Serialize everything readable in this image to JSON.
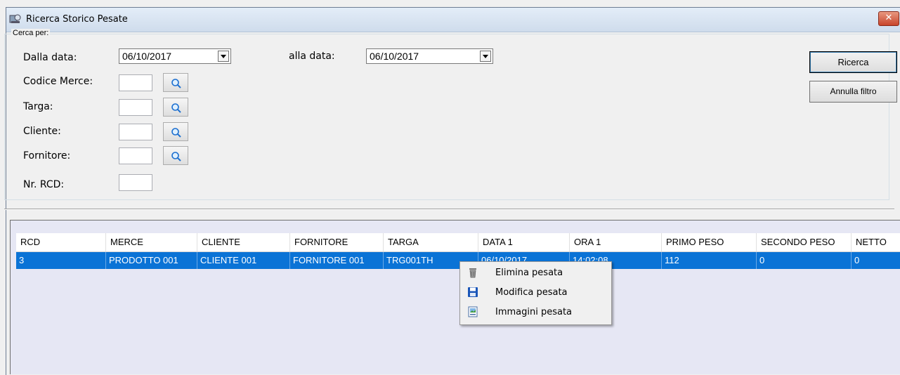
{
  "window": {
    "title": "Ricerca Storico Pesate",
    "close_glyph": "✕"
  },
  "search": {
    "group_title": "Cerca per:",
    "from_date_label": "Dalla data:",
    "from_date_value": "06/10/2017",
    "to_date_label": "alla data:",
    "to_date_value": "06/10/2017",
    "fields": [
      {
        "label": "Codice Merce:",
        "value": ""
      },
      {
        "label": "Targa:",
        "value": ""
      },
      {
        "label": "Cliente:",
        "value": ""
      },
      {
        "label": "Fornitore:",
        "value": ""
      },
      {
        "label": "Nr. RCD:",
        "value": ""
      }
    ],
    "search_button": "Ricerca",
    "clear_button": "Annulla filtro"
  },
  "grid": {
    "columns": [
      "RCD",
      "MERCE",
      "CLIENTE",
      "FORNITORE",
      "TARGA",
      "DATA 1",
      "ORA 1",
      "PRIMO PESO",
      "SECONDO PESO",
      "NETTO"
    ],
    "rows": [
      [
        "3",
        "PRODOTTO 001",
        "CLIENTE 001",
        "FORNITORE 001",
        "TRG001TH",
        "06/10/2017",
        "14:02:08",
        "112",
        "0",
        "0"
      ]
    ]
  },
  "context_menu": {
    "items": [
      {
        "label": "Elimina pesata",
        "icon": "trash-icon"
      },
      {
        "label": "Modifica pesata",
        "icon": "save-icon"
      },
      {
        "label": "Immagini pesata",
        "icon": "image-icon"
      }
    ]
  },
  "colors": {
    "selection": "#0a73d6",
    "grid_background": "#e6e7f4",
    "title_gradient": "#cfdcec"
  }
}
